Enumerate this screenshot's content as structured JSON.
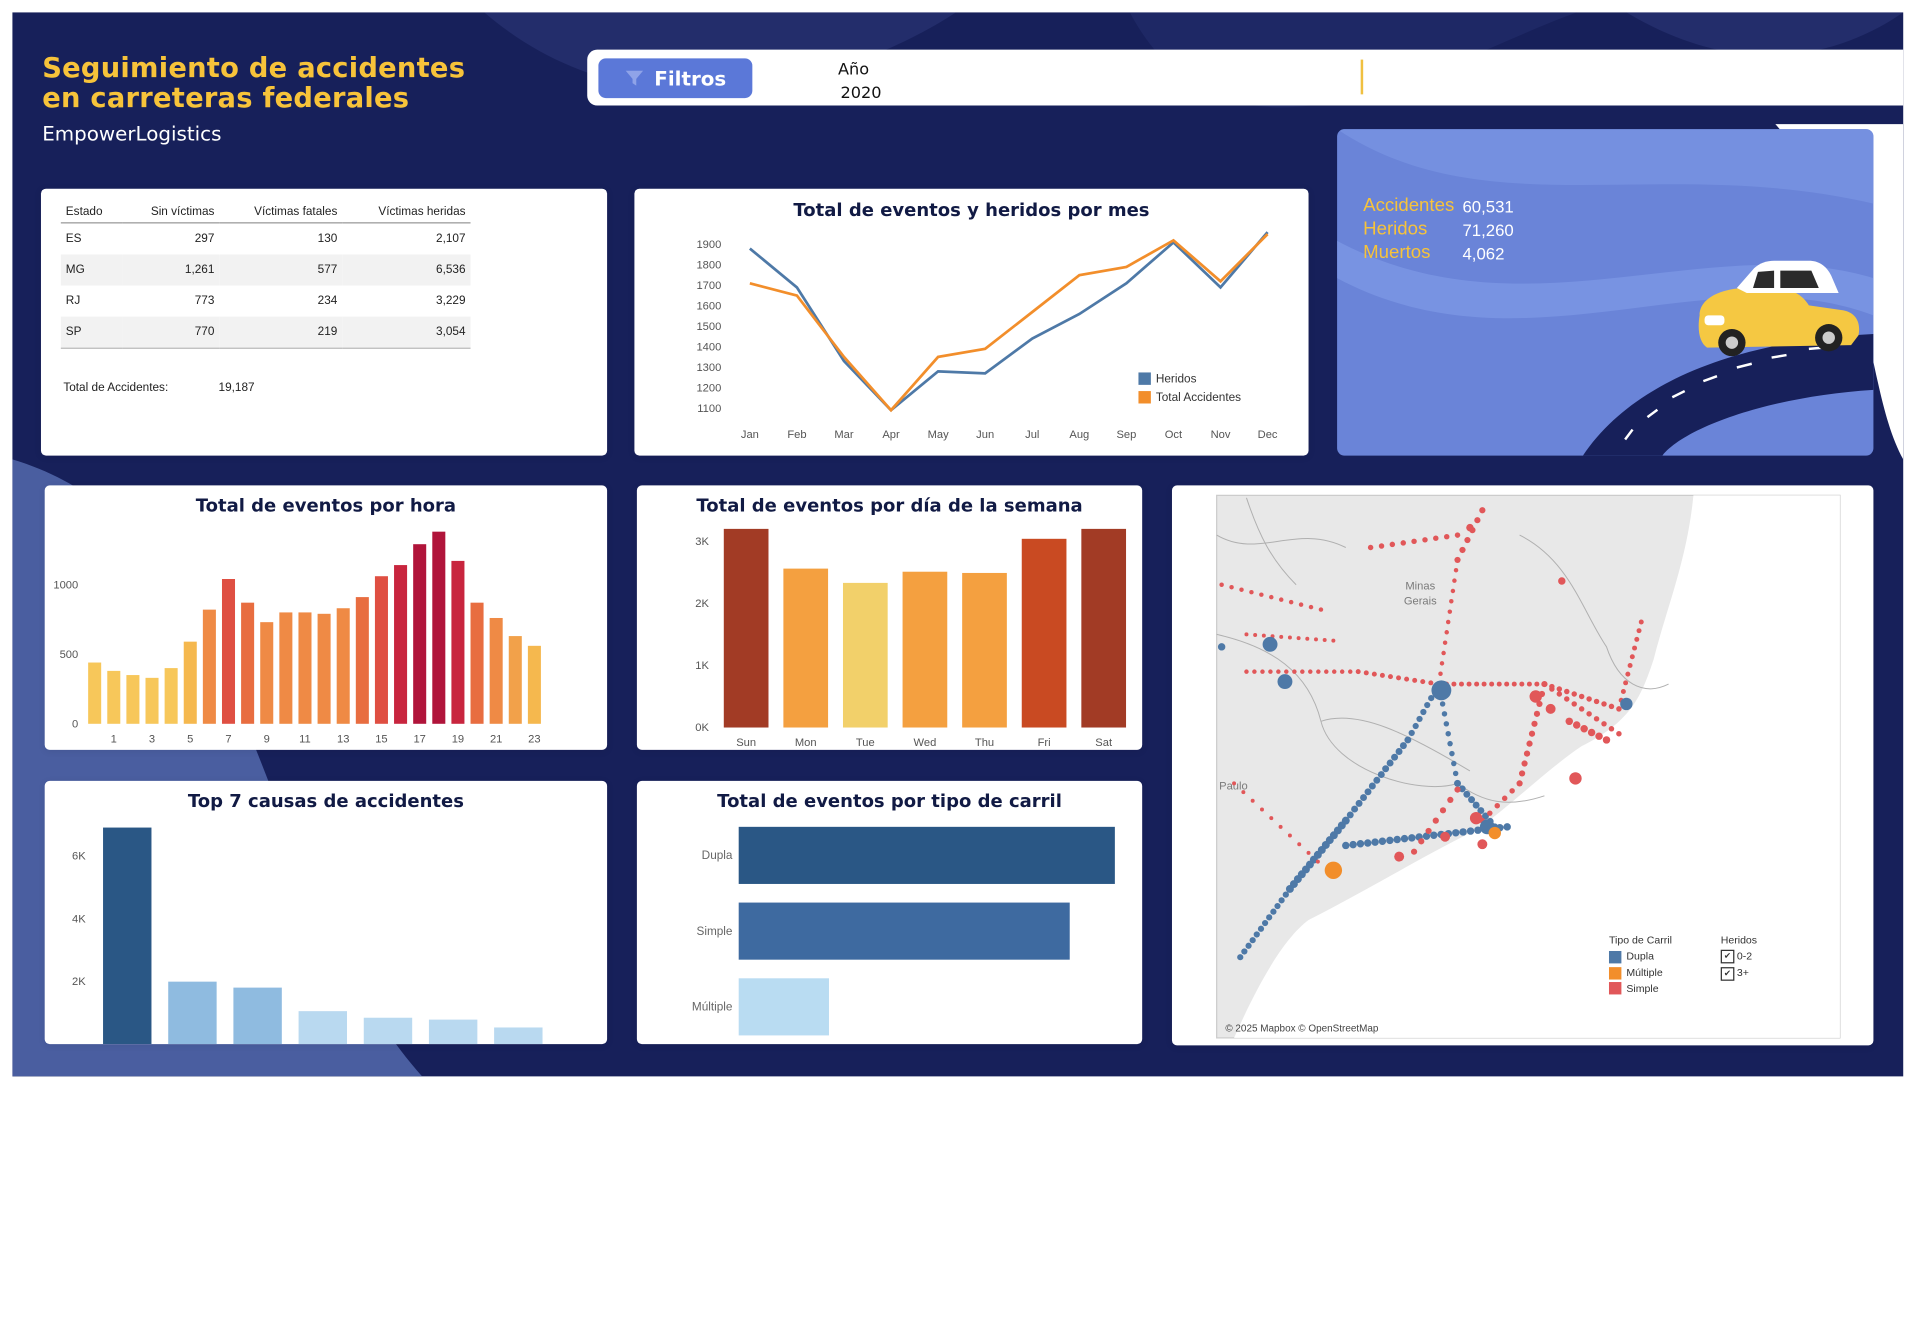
{
  "header": {
    "title_line1": "Seguimiento de accidentes",
    "title_line2": "en carreteras federales",
    "subtitle": "EmpowerLogistics",
    "filter_button": "Filtros",
    "year_label": "Año",
    "year_value": "2020"
  },
  "colors": {
    "navy": "#17205a",
    "accent_yellow": "#f7c33a",
    "kpi_blue": "#6a84d8",
    "heridos_blue": "#4e79a7",
    "total_orange": "#f28e2b",
    "simple_red": "#e15759"
  },
  "table": {
    "headers": [
      "Estado",
      "Sin víctimas",
      "Víctimas fatales",
      "Víctimas heridas"
    ],
    "rows": [
      [
        "ES",
        "297",
        "130",
        "2,107"
      ],
      [
        "MG",
        "1,261",
        "577",
        "6,536"
      ],
      [
        "RJ",
        "773",
        "234",
        "3,229"
      ],
      [
        "SP",
        "770",
        "219",
        "3,054"
      ]
    ],
    "total_label": "Total de Accidentes:",
    "total_value": "19,187"
  },
  "kpis": {
    "accidentes_label": "Accidentes",
    "accidentes_value": "60,531",
    "heridos_label": "Heridos",
    "heridos_value": "71,260",
    "muertos_label": "Muertos",
    "muertos_value": "4,062"
  },
  "chart_data": [
    {
      "id": "monthly",
      "type": "line",
      "title": "Total de eventos y heridos por mes",
      "categories": [
        "Jan",
        "Feb",
        "Mar",
        "Apr",
        "May",
        "Jun",
        "Jul",
        "Aug",
        "Sep",
        "Oct",
        "Nov",
        "Dec"
      ],
      "y_ticks": [
        1100,
        1200,
        1300,
        1400,
        1500,
        1600,
        1700,
        1800,
        1900
      ],
      "ylim": [
        1050,
        1960
      ],
      "series": [
        {
          "name": "Heridos",
          "color": "#4e79a7",
          "values": [
            1880,
            1690,
            1330,
            1090,
            1280,
            1270,
            1440,
            1560,
            1710,
            1910,
            1690,
            1960
          ]
        },
        {
          "name": "Total Accidentes",
          "color": "#f28e2b",
          "values": [
            1710,
            1650,
            1350,
            1090,
            1350,
            1390,
            1570,
            1750,
            1790,
            1920,
            1720,
            1950
          ]
        }
      ],
      "legend": "bottom-right"
    },
    {
      "id": "hourly",
      "type": "bar",
      "title": "Total de eventos por hora",
      "categories": [
        0,
        1,
        2,
        3,
        4,
        5,
        6,
        7,
        8,
        9,
        10,
        11,
        12,
        13,
        14,
        15,
        16,
        17,
        18,
        19,
        20,
        21,
        22,
        23
      ],
      "x_tick_labels": [
        "1",
        "3",
        "5",
        "7",
        "9",
        "11",
        "13",
        "15",
        "17",
        "19",
        "21",
        "23"
      ],
      "y_ticks": [
        0,
        500,
        1000
      ],
      "ylim": [
        0,
        1400
      ],
      "values": [
        440,
        380,
        350,
        330,
        400,
        590,
        820,
        1040,
        870,
        730,
        800,
        800,
        790,
        830,
        910,
        1060,
        1140,
        1290,
        1380,
        1170,
        870,
        760,
        630,
        560
      ]
    },
    {
      "id": "weekday",
      "type": "bar",
      "title": "Total de eventos por día de la semana",
      "categories": [
        "Sun",
        "Mon",
        "Tue",
        "Wed",
        "Thu",
        "Fri",
        "Sat"
      ],
      "y_ticks": [
        "0K",
        "1K",
        "2K",
        "3K"
      ],
      "ylim": [
        0,
        3300
      ],
      "values": [
        3200,
        2560,
        2330,
        2510,
        2490,
        3040,
        3200
      ],
      "colors": [
        "#a23b25",
        "#f4a040",
        "#f2d06a",
        "#f4a040",
        "#f4a040",
        "#c94a22",
        "#a23b25"
      ]
    },
    {
      "id": "causes",
      "type": "bar",
      "title": "Top 7 causas de accidentes",
      "y_ticks": [
        "2K",
        "4K",
        "6K"
      ],
      "ylim": [
        0,
        7200
      ],
      "values": [
        6900,
        1990,
        1800,
        1050,
        840,
        780,
        530
      ],
      "colors": [
        "#2a5785",
        "#8fbbe0",
        "#8fbbe0",
        "#b9d9f0",
        "#b9d9f0",
        "#b9d9f0",
        "#b9d9f0"
      ]
    },
    {
      "id": "lanes",
      "type": "bar",
      "orientation": "horizontal",
      "title": "Total de eventos por tipo de carril",
      "categories": [
        "Dupla",
        "Simple",
        "Múltiple"
      ],
      "values": [
        100,
        88,
        24
      ],
      "colors": [
        "#2a5785",
        "#3e6aa0",
        "#b9dcf2"
      ]
    }
  ],
  "map": {
    "region_labels": [
      "Minas\nGerais",
      "Paulo"
    ],
    "attribution": "© 2025 Mapbox © OpenStreetMap",
    "legend_lane_title": "Tipo de Carril",
    "legend_lanes": [
      {
        "label": "Dupla",
        "color": "#4e79a7"
      },
      {
        "label": "Múltiple",
        "color": "#f28e2b"
      },
      {
        "label": "Simple",
        "color": "#e15759"
      }
    ],
    "legend_size_title": "Heridos",
    "legend_sizes": [
      "0-2",
      "3+"
    ]
  }
}
